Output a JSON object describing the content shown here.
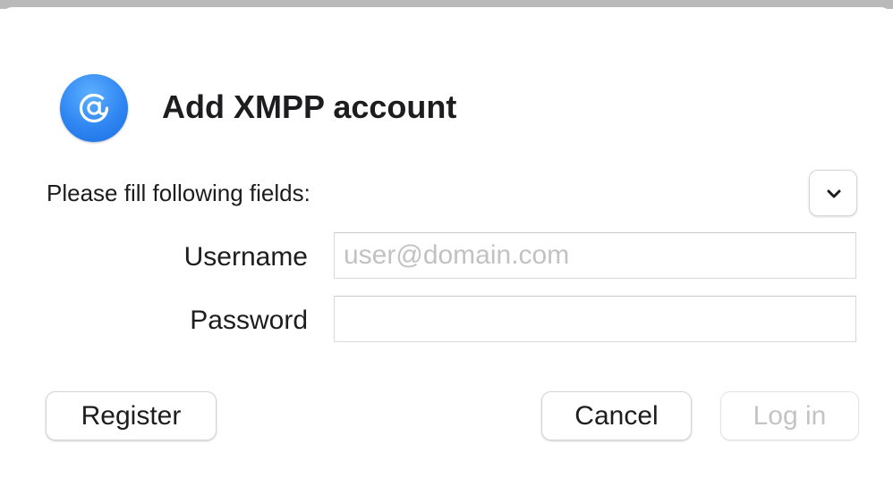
{
  "dialog": {
    "title": "Add XMPP account",
    "icon": "at-sign-icon",
    "accent_color": "#2f86f2"
  },
  "form": {
    "instructions": "Please fill following fields:",
    "disclosure_icon": "chevron-down-icon",
    "username": {
      "label": "Username",
      "value": "",
      "placeholder": "user@domain.com"
    },
    "password": {
      "label": "Password",
      "value": "",
      "placeholder": ""
    }
  },
  "buttons": {
    "register": "Register",
    "cancel": "Cancel",
    "login": "Log in"
  }
}
